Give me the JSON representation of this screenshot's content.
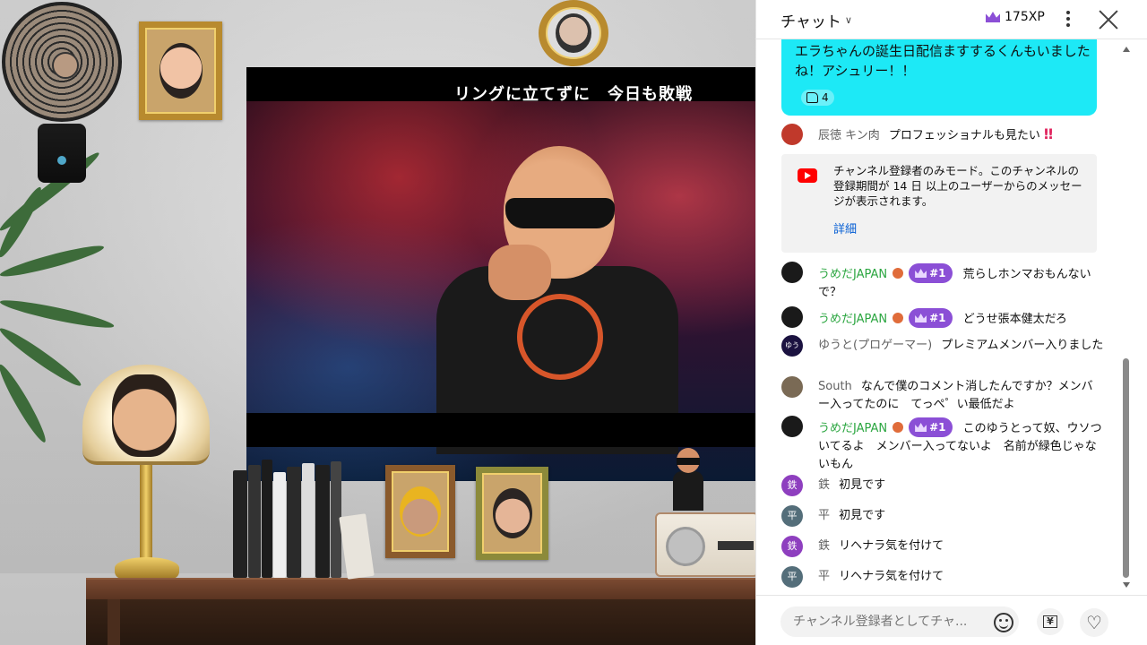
{
  "stream": {
    "video_caption": "リングに立てずに　今日も敗戦"
  },
  "chat": {
    "title": "チャット",
    "xp": "175XP",
    "superchat": {
      "text": "エラちゃんの誕生日配信ますするくんもいましたね！アシュリー！！",
      "likes": "4"
    },
    "messages_top": [
      {
        "author": "辰徳 キン肉",
        "text": "プロフェッショナルも見たい",
        "emoji": "‼",
        "avatar_color": "#c0392b",
        "avatar_initial": ""
      }
    ],
    "system_message": {
      "text": "チャンネル登録者のみモード。このチャンネルの登録期間が 14 日 以上のユーザーからのメッセージが表示されます。",
      "link": "詳細"
    },
    "messages": [
      {
        "author": "うめだJAPAN",
        "rank": "#1",
        "text": "荒らしホンマおもんないで？",
        "avatar_color": "#1a1a1a",
        "avatar_initial": "",
        "member": true
      },
      {
        "author": "うめだJAPAN",
        "rank": "#1",
        "text": "どうせ張本健太だろ",
        "avatar_color": "#1a1a1a",
        "avatar_initial": "",
        "member": true
      },
      {
        "author": "ゆうと(プロゲーマー)",
        "rank": "",
        "text": "プレミアムメンバー入りました",
        "avatar_color": "#1b1240",
        "avatar_initial": "ゆう",
        "member": false
      },
      {
        "author": "South",
        "rank": "",
        "text": "なんで僕のコメント消したんですか？メンバー入ってたのに　てっぺ゜い最低だよ",
        "avatar_color": "#7a6a55",
        "avatar_initial": "",
        "member": false
      },
      {
        "author": "うめだJAPAN",
        "rank": "#1",
        "text": "このゆうとって奴、ウソついてるよ　メンバー入ってないよ　名前が緑色じゃないもん",
        "avatar_color": "#1a1a1a",
        "avatar_initial": "",
        "member": true
      },
      {
        "author": "鉄",
        "rank": "",
        "text": "初見です",
        "avatar_color": "#8e3fbf",
        "avatar_initial": "鉄",
        "member": false
      },
      {
        "author": "平",
        "rank": "",
        "text": "初見です",
        "avatar_color": "#546e7a",
        "avatar_initial": "平",
        "member": false
      },
      {
        "author": "鉄",
        "rank": "",
        "text": "リヘナラ気を付けて",
        "avatar_color": "#8e3fbf",
        "avatar_initial": "鉄",
        "member": false
      },
      {
        "author": "平",
        "rank": "",
        "text": "リヘナラ気を付けて",
        "avatar_color": "#546e7a",
        "avatar_initial": "平",
        "member": false
      }
    ],
    "input_placeholder": "チャンネル登録者としてチャ...",
    "yen_label": "¥",
    "heart_icon": "♡"
  }
}
